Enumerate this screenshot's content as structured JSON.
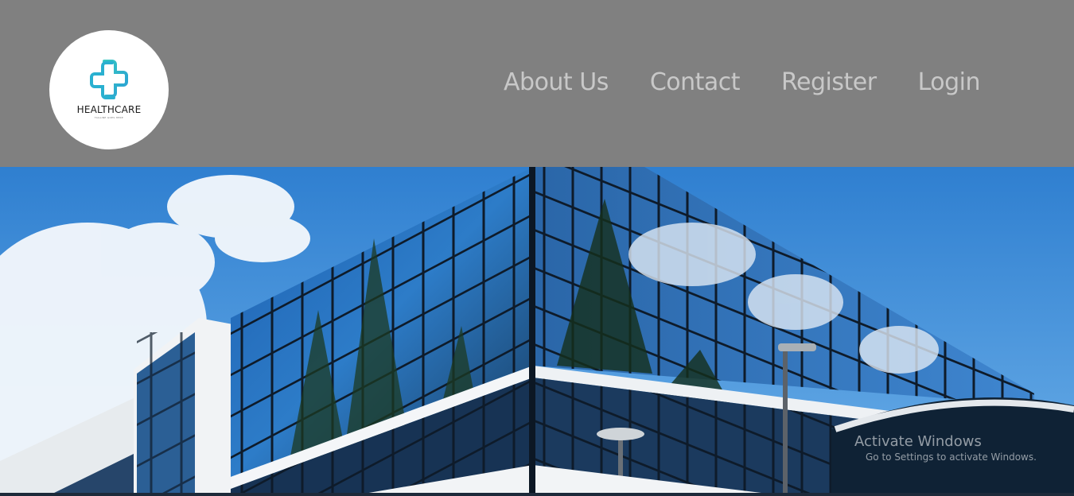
{
  "brand": {
    "name": "HEALTHCARE",
    "tagline": "TAGLINE GOES HERE",
    "logo_icon": "medical-cross-icon",
    "accent": "#2bb8c9"
  },
  "nav": {
    "items": [
      {
        "label": "About Us"
      },
      {
        "label": "Contact"
      },
      {
        "label": "Register"
      },
      {
        "label": "Login"
      }
    ]
  },
  "hero": {
    "image": "glass-office-building"
  },
  "os_watermark": {
    "title": "Activate Windows",
    "subtitle": "Go to Settings to activate Windows."
  },
  "colors": {
    "header_bg": "#808080",
    "nav_text": "#c8c8c8",
    "sky": "#3f8fd9"
  }
}
